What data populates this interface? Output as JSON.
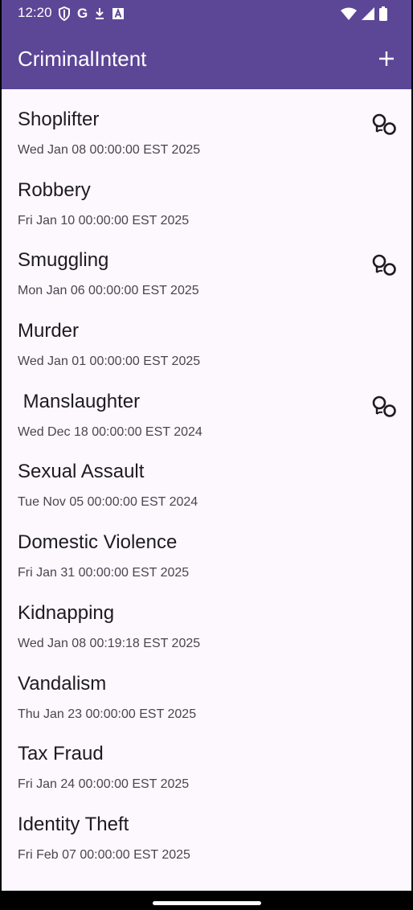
{
  "status_bar": {
    "time": "12:20",
    "left_icons": [
      "shield-icon",
      "google-icon",
      "download-icon",
      "a-box-icon"
    ],
    "right_icons": [
      "wifi-icon",
      "signal-icon",
      "battery-icon"
    ]
  },
  "app_bar": {
    "title": "CriminalIntent",
    "add_icon": "plus-icon",
    "background": "#5C4696"
  },
  "crimes": [
    {
      "title": "Shoplifter",
      "date": "Wed Jan 08 00:00:00 EST 2025",
      "solved": true
    },
    {
      "title": "Robbery",
      "date": "Fri Jan 10 00:00:00 EST 2025",
      "solved": false
    },
    {
      "title": "Smuggling",
      "date": "Mon Jan 06 00:00:00 EST 2025",
      "solved": true
    },
    {
      "title": "Murder",
      "date": "Wed Jan 01 00:00:00 EST 2025",
      "solved": false
    },
    {
      "title": " Manslaughter",
      "date": "Wed Dec 18 00:00:00 EST 2024",
      "solved": true
    },
    {
      "title": "Sexual Assault",
      "date": "Tue Nov 05 00:00:00 EST 2024",
      "solved": false
    },
    {
      "title": "Domestic Violence",
      "date": "Fri Jan 31 00:00:00 EST 2025",
      "solved": false
    },
    {
      "title": "Kidnapping",
      "date": "Wed Jan 08 00:19:18 EST 2025",
      "solved": false
    },
    {
      "title": "Vandalism",
      "date": "Thu Jan 23 00:00:00 EST 2025",
      "solved": false
    },
    {
      "title": "Tax Fraud",
      "date": "Fri Jan 24 00:00:00 EST 2025",
      "solved": false
    },
    {
      "title": "Identity Theft",
      "date": "Fri Feb 07 00:00:00 EST 2025",
      "solved": false
    }
  ]
}
